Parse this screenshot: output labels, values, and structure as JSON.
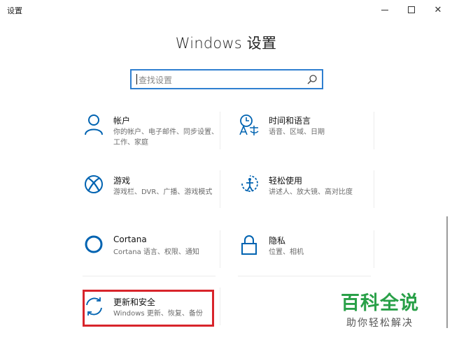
{
  "window": {
    "title": "设置",
    "minimize_glyph": "–",
    "maximize_glyph": "□",
    "close_glyph": "✕"
  },
  "page": {
    "title": "Windows 设置"
  },
  "search": {
    "placeholder": "查找设置",
    "icon": "search-icon"
  },
  "tiles": [
    {
      "icon": "person-icon",
      "title": "帐户",
      "desc": "你的帐户、电子邮件、同步设置、工作、家庭"
    },
    {
      "icon": "language-icon",
      "title": "时间和语言",
      "desc": "语音、区域、日期"
    },
    {
      "icon": "xbox-icon",
      "title": "游戏",
      "desc": "游戏栏、DVR、广播、游戏模式"
    },
    {
      "icon": "ease-of-access-icon",
      "title": "轻松使用",
      "desc": "讲述人、放大镜、高对比度"
    },
    {
      "icon": "cortana-icon",
      "title": "Cortana",
      "desc": "Cortana 语言、权限、通知"
    },
    {
      "icon": "lock-icon",
      "title": "隐私",
      "desc": "位置、相机"
    },
    {
      "icon": "sync-icon",
      "title": "更新和安全",
      "desc": "Windows 更新、恢复、备份"
    }
  ],
  "watermark": {
    "title": "百科全说",
    "subtitle": "助你轻松解决"
  },
  "colors": {
    "accent": "#0063b1",
    "search_border": "#2f7fd0",
    "highlight": "#d8242b",
    "watermark": "#29a048"
  }
}
